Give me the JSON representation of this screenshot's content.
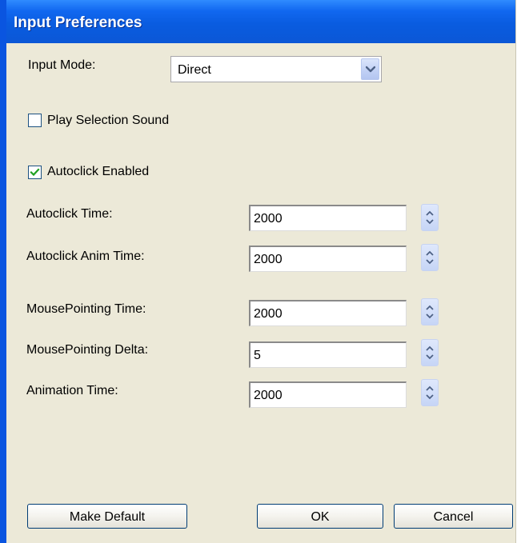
{
  "window": {
    "title": "Input Preferences"
  },
  "input_mode": {
    "label": "Input Mode:",
    "selected": "Direct",
    "arrow_icon": "chevron-down-icon"
  },
  "play_selection_sound": {
    "label": "Play Selection Sound",
    "checked": false
  },
  "autoclick_enabled": {
    "label": "Autoclick Enabled",
    "checked": true
  },
  "fields": [
    {
      "label": "Autoclick Time:",
      "value": "2000"
    },
    {
      "label": "Autoclick Anim Time:",
      "value": "2000"
    },
    {
      "label": "MousePointing Time:",
      "value": "2000"
    },
    {
      "label": "MousePointing Delta:",
      "value": "5"
    },
    {
      "label": "Animation Time:",
      "value": "2000"
    }
  ],
  "buttons": {
    "make_default": "Make Default",
    "ok": "OK",
    "cancel": "Cancel"
  },
  "colors": {
    "titlebar": "#0a5ce0",
    "background": "#ece9d8",
    "checkmark": "#21a121"
  }
}
